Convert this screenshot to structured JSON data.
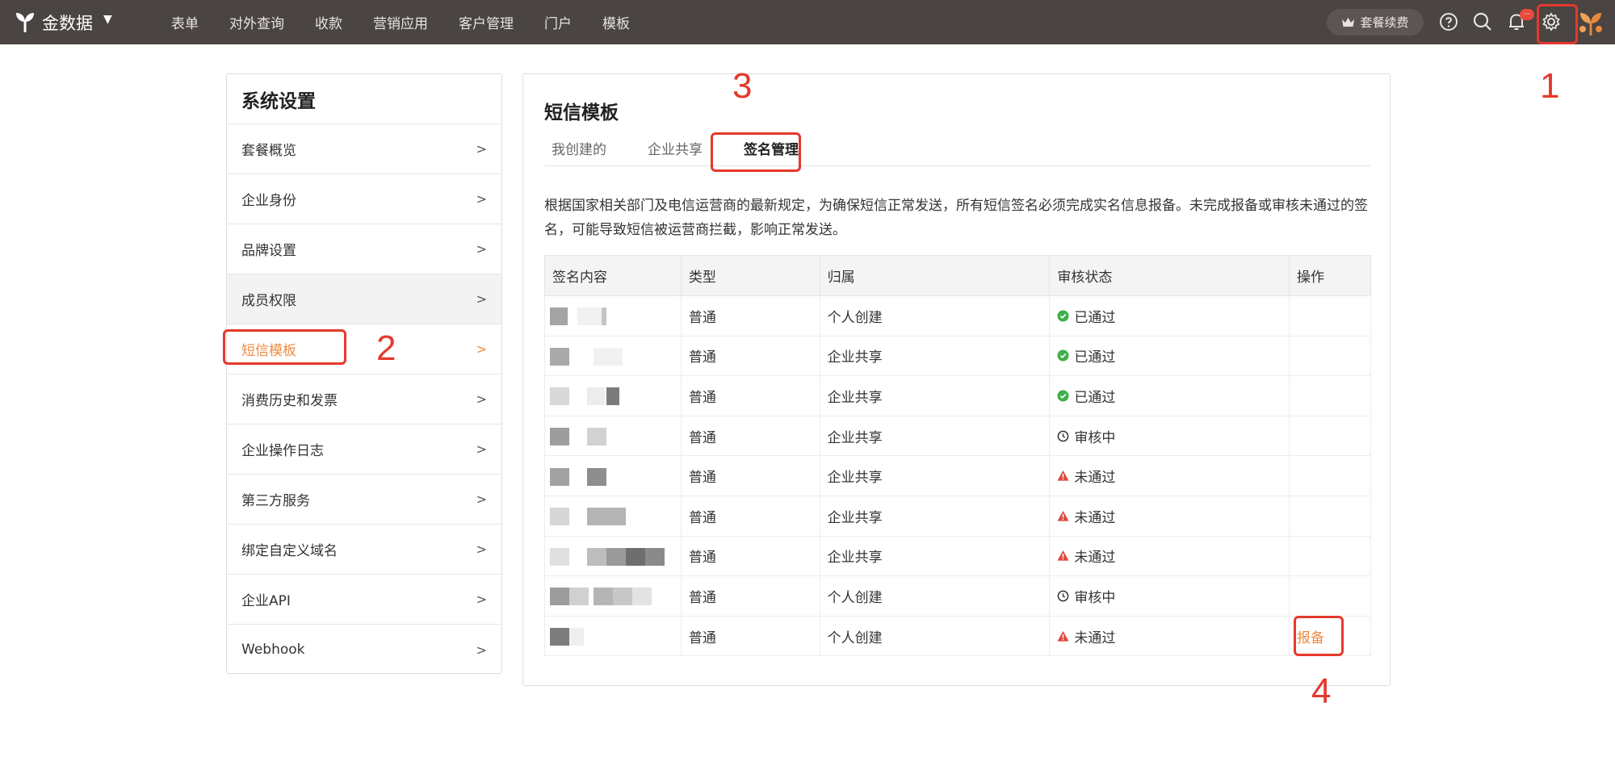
{
  "topbar": {
    "brand": "金数据",
    "nav": [
      "表单",
      "对外查询",
      "收款",
      "营销应用",
      "客户管理",
      "门户",
      "模板"
    ],
    "upgrade_label": "套餐续费",
    "badge": "···"
  },
  "annotations": [
    "1",
    "2",
    "3",
    "4"
  ],
  "left": {
    "title": "系统设置",
    "items": [
      "套餐概览",
      "企业身份",
      "品牌设置",
      "成员权限",
      "短信模板",
      "消费历史和发票",
      "企业操作日志",
      "第三方服务",
      "绑定自定义域名",
      "企业API",
      "Webhook"
    ]
  },
  "right": {
    "title": "短信模板",
    "tabs": [
      "我创建的",
      "企业共享",
      "签名管理"
    ],
    "notice": "根据国家相关部门及电信运营商的最新规定，为确保短信正常发送，所有短信签名必须完成实名信息报备。未完成报备或审核未通过的签名，可能导致短信被运营商拦截，影响正常发送。",
    "columns": [
      "签名内容",
      "类型",
      "归属",
      "审核状态",
      "操作"
    ],
    "rows": [
      {
        "type": "普通",
        "owner": "个人创建",
        "status": "已通过",
        "status_kind": "passed",
        "action": ""
      },
      {
        "type": "普通",
        "owner": "企业共享",
        "status": "已通过",
        "status_kind": "passed",
        "action": ""
      },
      {
        "type": "普通",
        "owner": "企业共享",
        "status": "已通过",
        "status_kind": "passed",
        "action": ""
      },
      {
        "type": "普通",
        "owner": "企业共享",
        "status": "审核中",
        "status_kind": "pending",
        "action": ""
      },
      {
        "type": "普通",
        "owner": "企业共享",
        "status": "未通过",
        "status_kind": "failed",
        "action": ""
      },
      {
        "type": "普通",
        "owner": "企业共享",
        "status": "未通过",
        "status_kind": "failed",
        "action": ""
      },
      {
        "type": "普通",
        "owner": "企业共享",
        "status": "未通过",
        "status_kind": "failed",
        "action": ""
      },
      {
        "type": "普通",
        "owner": "个人创建",
        "status": "审核中",
        "status_kind": "pending",
        "action": ""
      },
      {
        "type": "普通",
        "owner": "个人创建",
        "status": "未通过",
        "status_kind": "failed",
        "action": "报备"
      }
    ]
  },
  "colors": {
    "accent": "#ef8a3e",
    "annotation": "#e5392c",
    "topbar": "#4a4442",
    "passed": "#3fae49",
    "failed": "#e0483b"
  }
}
